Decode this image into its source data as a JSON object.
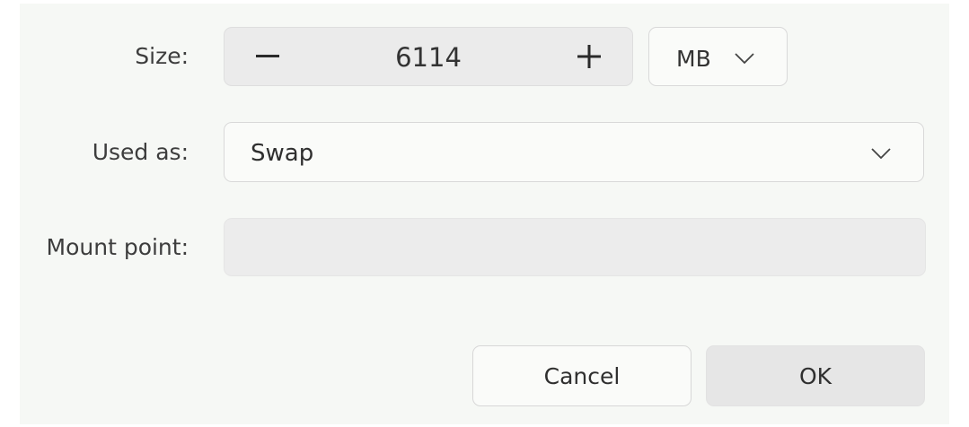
{
  "dialog": {
    "size": {
      "label": "Size:",
      "value": "6114",
      "decrement_icon": "minus-icon",
      "increment_icon": "plus-icon",
      "unit": "MB",
      "unit_icon": "chevron-down-icon"
    },
    "used_as": {
      "label": "Used as:",
      "value": "Swap",
      "icon": "chevron-down-icon"
    },
    "mount_point": {
      "label": "Mount point:",
      "value": ""
    },
    "buttons": {
      "cancel_label": "Cancel",
      "ok_label": "OK"
    }
  }
}
